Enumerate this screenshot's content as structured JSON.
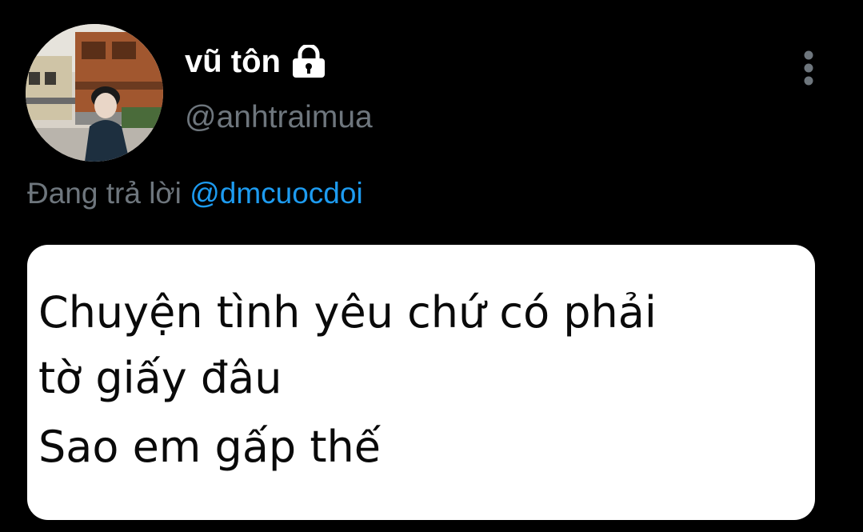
{
  "tweet": {
    "author": {
      "display_name": "vũ tôn",
      "handle": "@anhtraimua",
      "protected_icon": "lock-icon",
      "avatar_icon": "profile-photo"
    },
    "reply_context": {
      "prefix": "Đang trả lời",
      "mention": "@dmcuocdoi"
    },
    "more_icon": "vertical-ellipsis-icon",
    "media_text": {
      "line1": "Chuyện tình yêu chứ có phải",
      "line2": "tờ giấy đâu",
      "line3": "Sao em gấp thế"
    }
  },
  "colors": {
    "background": "#000000",
    "primary_text": "#ffffff",
    "secondary_text": "#6e767d",
    "link": "#1d9bf0",
    "card_background": "#ffffff",
    "card_text": "#0a0a0a"
  }
}
